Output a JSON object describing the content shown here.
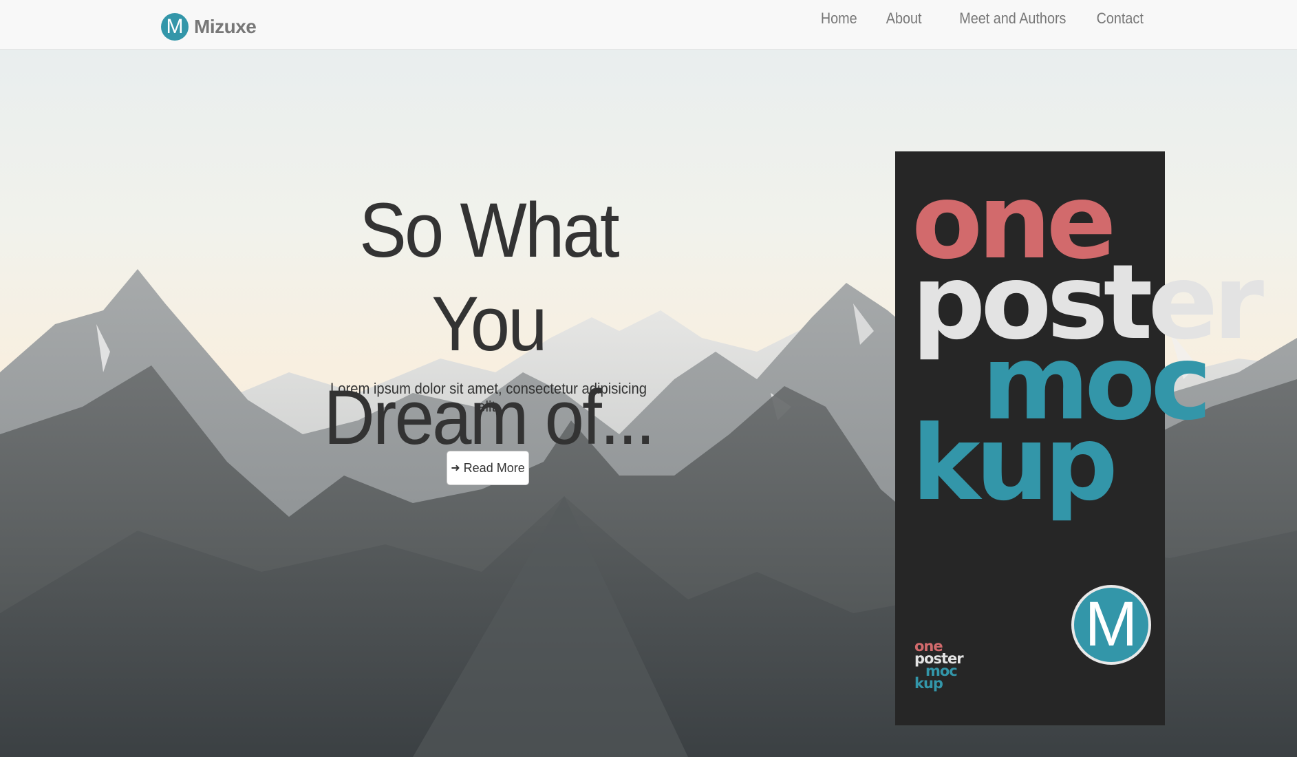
{
  "navbar": {
    "brand": {
      "logo_letter": "M",
      "name": "Mizuxe"
    },
    "links": [
      "Home",
      "About",
      "Meet and Authors",
      "Contact"
    ]
  },
  "hero": {
    "title_lines": [
      "So What You",
      "Dream of..."
    ],
    "subtitle": "Lorem ipsum dolor sit amet, consectetur adipisicing elit.",
    "button": {
      "icon": "arrow-right-icon",
      "label": "Read More"
    }
  },
  "poster": {
    "words": [
      "one",
      "poster",
      "moc",
      "kup"
    ],
    "small_words": [
      "one",
      "poster",
      "moc",
      "kup"
    ],
    "logo_letter": "M"
  },
  "colors": {
    "accent": "#3396a9",
    "poster_red": "#d26a6c",
    "poster_bg": "#262626",
    "nav_text": "#777777",
    "heading_text": "#333333"
  }
}
